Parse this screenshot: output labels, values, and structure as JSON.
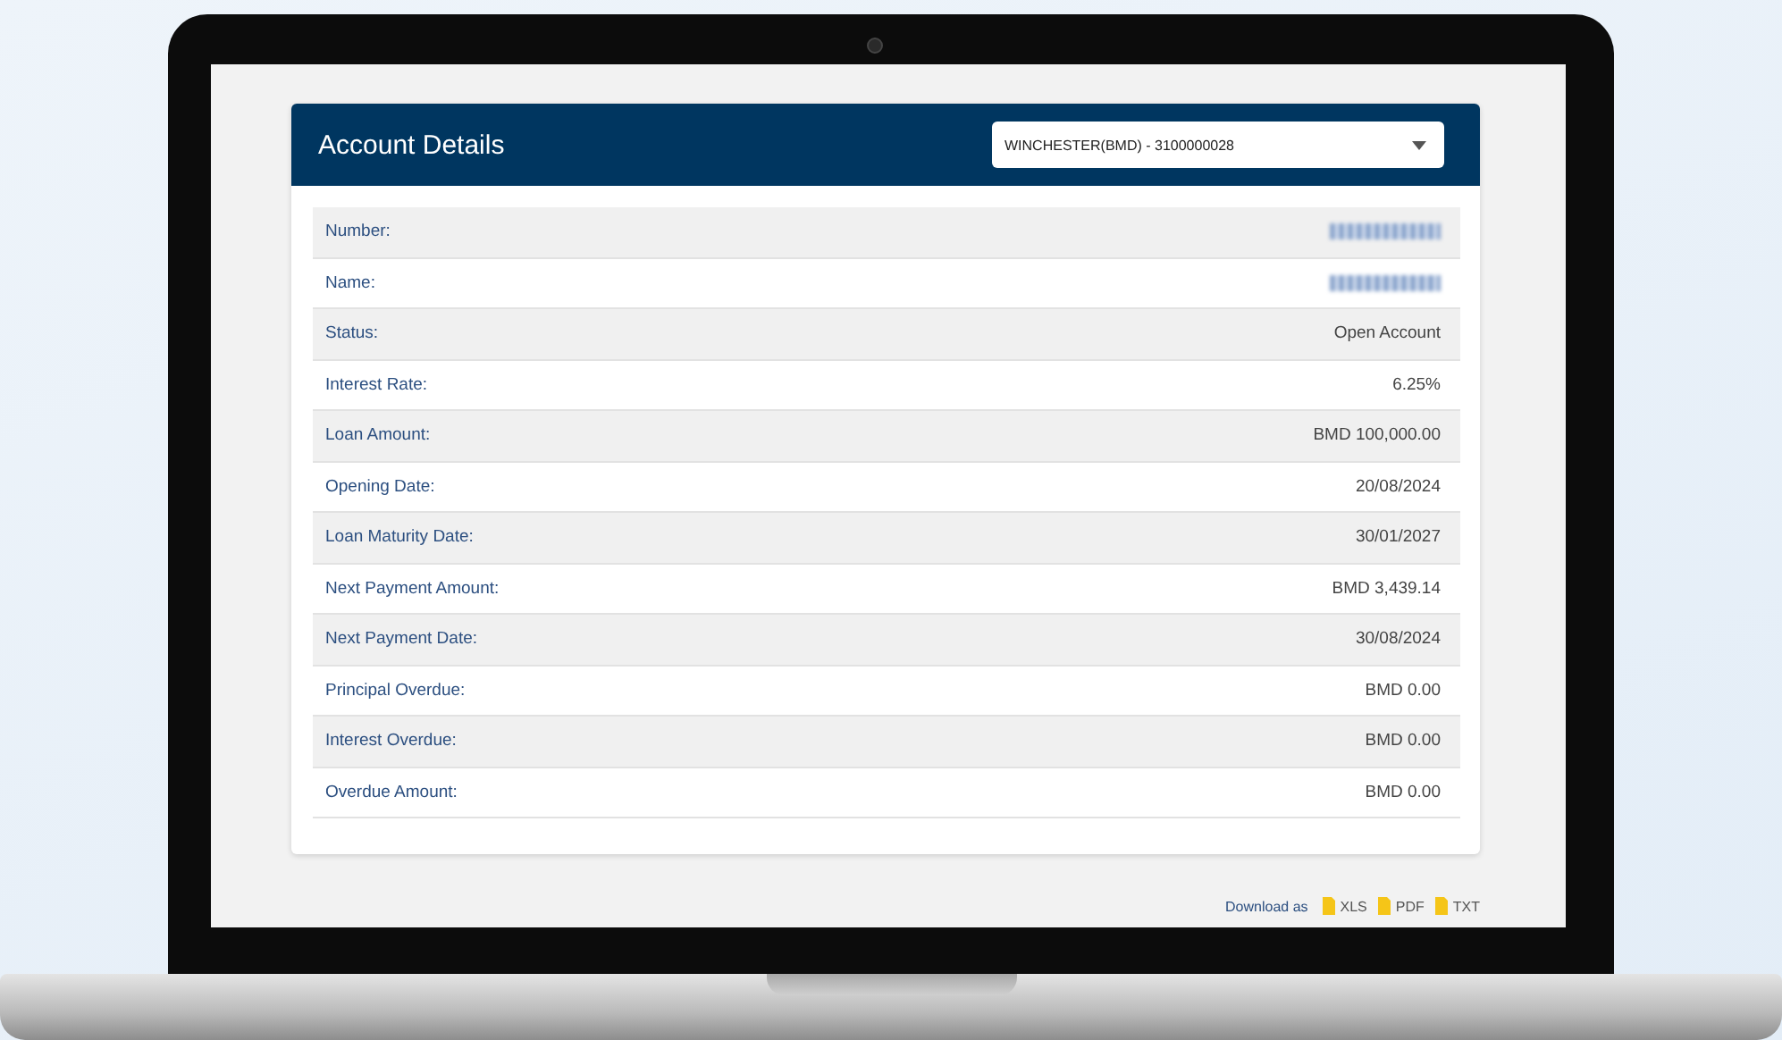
{
  "panel": {
    "title": "Account Details",
    "account_select": {
      "value": "WINCHESTER(BMD)  - 3100000028"
    }
  },
  "rows": [
    {
      "label": "Number:",
      "kind": "masked"
    },
    {
      "label": "Name:",
      "kind": "masked"
    },
    {
      "label": "Status:",
      "kind": "text",
      "value": "Open Account"
    },
    {
      "label": "Interest Rate:",
      "kind": "text",
      "value": "6.25%"
    },
    {
      "label": "Loan Amount:",
      "kind": "text",
      "value": "BMD 100,000.00"
    },
    {
      "label": "Opening Date:",
      "kind": "text",
      "value": "20/08/2024"
    },
    {
      "label": "Loan Maturity Date:",
      "kind": "text",
      "value": "30/01/2027"
    },
    {
      "label": "Next Payment Amount:",
      "kind": "text",
      "value": "BMD 3,439.14"
    },
    {
      "label": "Next Payment Date:",
      "kind": "text",
      "value": "30/08/2024"
    },
    {
      "label": "Principal Overdue:",
      "kind": "text",
      "value": "BMD 0.00"
    },
    {
      "label": "Interest Overdue:",
      "kind": "text",
      "value": "BMD 0.00"
    },
    {
      "label": "Overdue Amount:",
      "kind": "text",
      "value": "BMD 0.00"
    }
  ],
  "download": {
    "label": "Download as",
    "formats": [
      "XLS",
      "PDF",
      "TXT"
    ]
  }
}
